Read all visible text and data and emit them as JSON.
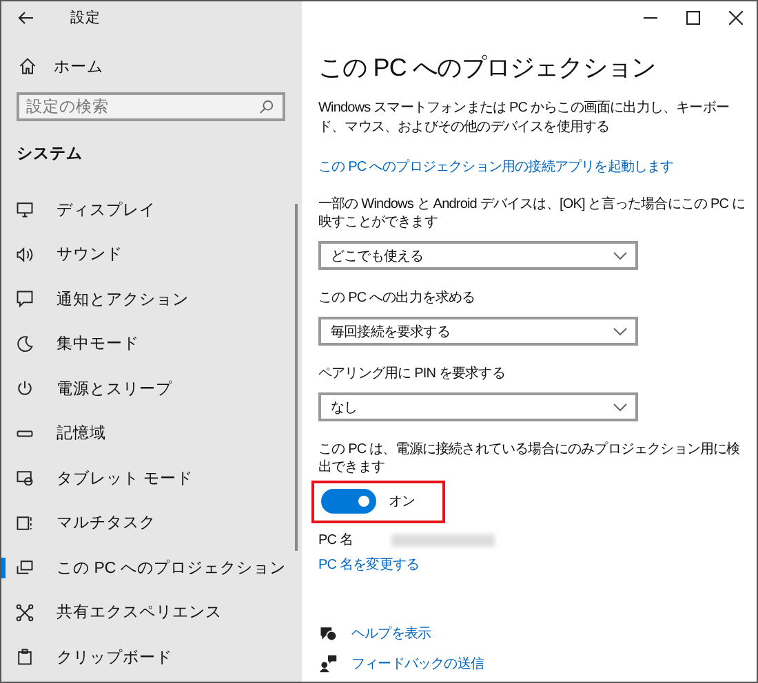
{
  "window": {
    "title": "設定"
  },
  "sidebar": {
    "home": "ホーム",
    "search": {
      "placeholder": "設定の検索"
    },
    "section": "システム",
    "items": [
      {
        "label": "ディスプレイ",
        "selected": false
      },
      {
        "label": "サウンド",
        "selected": false
      },
      {
        "label": "通知とアクション",
        "selected": false
      },
      {
        "label": "集中モード",
        "selected": false
      },
      {
        "label": "電源とスリープ",
        "selected": false
      },
      {
        "label": "記憶域",
        "selected": false
      },
      {
        "label": "タブレット モード",
        "selected": false
      },
      {
        "label": "マルチタスク",
        "selected": false
      },
      {
        "label": "この PC へのプロジェクション",
        "selected": true
      },
      {
        "label": "共有エクスペリエンス",
        "selected": false
      },
      {
        "label": "クリップボード",
        "selected": false
      }
    ]
  },
  "content": {
    "title": "この PC へのプロジェクション",
    "description": "Windows スマートフォンまたは PC からこの画面に出力し、キーボード、マウス、およびその他のデバイスを使用する",
    "launch_link": "この PC へのプロジェクション用の接続アプリを起動します",
    "settings": [
      {
        "label": "一部の Windows と Android デバイスは、[OK] と言った場合にこの PC に映すことができます",
        "value": "どこでも使える"
      },
      {
        "label": "この PC への出力を求める",
        "value": "毎回接続を要求する"
      },
      {
        "label": "ペアリング用に PIN を要求する",
        "value": "なし"
      }
    ],
    "power": {
      "label": "この PC は、電源に接続されている場合にのみプロジェクション用に検出できます",
      "on": true,
      "state_text": "オン",
      "highlighted": true
    },
    "pc_name_label": "PC 名",
    "rename_link": "PC 名を変更する",
    "help_links": [
      "ヘルプを表示",
      "フィードバックの送信"
    ]
  }
}
